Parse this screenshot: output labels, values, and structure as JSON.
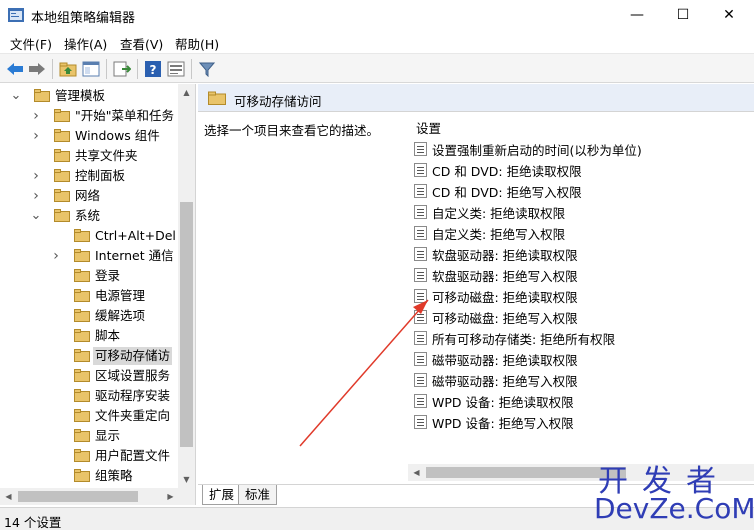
{
  "window": {
    "title": "本地组策略编辑器",
    "minimize_glyph": "—",
    "maximize_glyph": "☐",
    "close_glyph": "✕"
  },
  "menu": {
    "items": [
      {
        "label": "文件(F)"
      },
      {
        "label": "操作(A)"
      },
      {
        "label": "查看(V)"
      },
      {
        "label": "帮助(H)"
      }
    ]
  },
  "toolbar": {
    "buttons": [
      "back-icon",
      "forward-icon",
      "up-folder-icon",
      "show-hide-tree-icon",
      "export-list-icon",
      "help-icon",
      "properties-icon",
      "filter-icon"
    ]
  },
  "tree": {
    "items": [
      {
        "label": "管理模板",
        "expanded": true
      },
      {
        "label": "\"开始\"菜单和任务",
        "expandable": true
      },
      {
        "label": "Windows 组件",
        "expandable": true
      },
      {
        "label": "共享文件夹"
      },
      {
        "label": "控制面板",
        "expandable": true
      },
      {
        "label": "网络",
        "expandable": true
      },
      {
        "label": "系统",
        "expanded": true
      },
      {
        "label": "Ctrl+Alt+Del"
      },
      {
        "label": "Internet 通信",
        "expandable": true
      },
      {
        "label": "登录"
      },
      {
        "label": "电源管理"
      },
      {
        "label": "缓解选项"
      },
      {
        "label": "脚本"
      },
      {
        "label": "可移动存储访",
        "selected": true
      },
      {
        "label": "区域设置服务"
      },
      {
        "label": "驱动程序安装"
      },
      {
        "label": "文件夹重定向"
      },
      {
        "label": "显示"
      },
      {
        "label": "用户配置文件"
      },
      {
        "label": "组策略"
      }
    ]
  },
  "right_pane": {
    "header_title": "可移动存储访问",
    "description_hint": "选择一个项目来查看它的描述。",
    "settings_column_header": "设置",
    "settings": [
      "设置强制重新启动的时间(以秒为单位)",
      "CD 和 DVD: 拒绝读取权限",
      "CD 和 DVD: 拒绝写入权限",
      "自定义类: 拒绝读取权限",
      "自定义类: 拒绝写入权限",
      "软盘驱动器: 拒绝读取权限",
      "软盘驱动器: 拒绝写入权限",
      "可移动磁盘: 拒绝读取权限",
      "可移动磁盘: 拒绝写入权限",
      "所有可移动存储类: 拒绝所有权限",
      "磁带驱动器: 拒绝读取权限",
      "磁带驱动器: 拒绝写入权限",
      "WPD 设备: 拒绝读取权限",
      "WPD 设备: 拒绝写入权限"
    ],
    "tabs": [
      {
        "label": "扩展",
        "active": true
      },
      {
        "label": "标准",
        "active": false
      }
    ]
  },
  "statusbar": {
    "text": "14 个设置"
  },
  "watermark": {
    "line1": "开发者",
    "line2": "DevZe.CoM"
  },
  "colors": {
    "folder": "#e9c46a",
    "annotation_arrow": "#e03a2a",
    "watermark": "#2f3db5"
  }
}
